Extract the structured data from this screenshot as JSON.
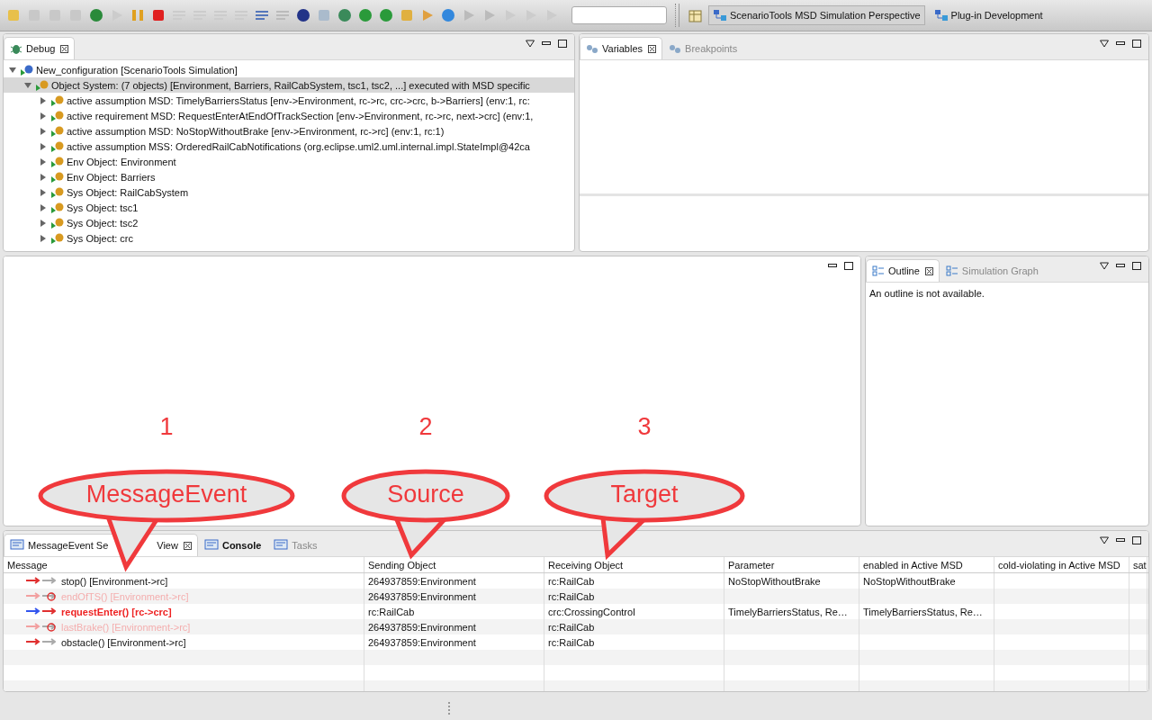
{
  "perspectives": [
    {
      "label": "ScenarioTools MSD Simulation Perspective",
      "selected": true
    },
    {
      "label": "Plug-in Development",
      "selected": false
    }
  ],
  "debug": {
    "tab": "Debug",
    "tree": [
      {
        "label": "New_configuration [ScenarioTools Simulation]",
        "kind": "launch",
        "expanded": true,
        "selected": false,
        "children": [
          {
            "label": "Object System: (7 objects) [Environment, Barriers, RailCabSystem, tsc1, tsc2, ...] executed with MSD specific",
            "kind": "system",
            "expanded": true,
            "selected": true,
            "children": [
              {
                "label": "active assumption MSD: TimelyBarriersStatus [env->Environment, rc->rc, crc->crc, b->Barriers] (env:1, rc:",
                "kind": "object",
                "expanded": false,
                "selected": false
              },
              {
                "label": "active requirement MSD: RequestEnterAtEndOfTrackSection [env->Environment, rc->rc, next->crc] (env:1,",
                "kind": "object",
                "expanded": false,
                "selected": false
              },
              {
                "label": "active assumption MSD: NoStopWithoutBrake [env->Environment, rc->rc] (env:1, rc:1)",
                "kind": "object",
                "expanded": false,
                "selected": false
              },
              {
                "label": "active assumption MSS: OrderedRailCabNotifications  (org.eclipse.uml2.uml.internal.impl.StateImpl@42ca",
                "kind": "object",
                "expanded": false,
                "selected": false
              },
              {
                "label": "Env Object: Environment",
                "kind": "object",
                "expanded": false,
                "selected": false
              },
              {
                "label": "Env Object: Barriers",
                "kind": "object",
                "expanded": false,
                "selected": false
              },
              {
                "label": "Sys Object: RailCabSystem",
                "kind": "object",
                "expanded": false,
                "selected": false
              },
              {
                "label": "Sys Object: tsc1",
                "kind": "object",
                "expanded": false,
                "selected": false
              },
              {
                "label": "Sys Object: tsc2",
                "kind": "object",
                "expanded": false,
                "selected": false
              },
              {
                "label": "Sys Object: crc",
                "kind": "object",
                "expanded": false,
                "selected": false
              }
            ]
          }
        ]
      }
    ]
  },
  "variables": {
    "tabs": [
      {
        "label": "Variables",
        "selected": true
      },
      {
        "label": "Breakpoints",
        "selected": false
      }
    ]
  },
  "outline": {
    "tabs": [
      {
        "label": "Outline",
        "selected": true
      },
      {
        "label": "Simulation Graph",
        "selected": false
      }
    ],
    "message": "An outline is not available."
  },
  "message_view": {
    "tabs": [
      {
        "label": "MessageEvent Se",
        "label_end": "View",
        "selected": true,
        "bold": false
      },
      {
        "label": "Console",
        "selected": false,
        "bold": true
      },
      {
        "label": "Tasks",
        "selected": false,
        "bold": false
      }
    ],
    "columns": [
      "Message",
      "Sending Object",
      "Receiving Object",
      "Parameter",
      "enabled in Active MSD",
      "cold-violating in Active MSD",
      "sat"
    ],
    "rows": [
      {
        "kind": "normal",
        "message": "stop() [Environment->rc]",
        "sending_object": "264937859:Environment",
        "receiving_object": "rc:RailCab",
        "parameter": "NoStopWithoutBrake",
        "enabled_in_active_msd": "NoStopWithoutBrake"
      },
      {
        "kind": "disabled",
        "message": "endOfTS() [Environment->rc]",
        "sending_object": "264937859:Environment",
        "receiving_object": "rc:RailCab"
      },
      {
        "kind": "active",
        "message": "requestEnter() [rc->crc]",
        "sending_object": "rc:RailCab",
        "receiving_object": "crc:CrossingControl",
        "parameter": "TimelyBarriersStatus, Re…",
        "enabled_in_active_msd": "TimelyBarriersStatus, Re…"
      },
      {
        "kind": "disabled",
        "message": "lastBrake() [Environment->rc]",
        "sending_object": "264937859:Environment",
        "receiving_object": "rc:RailCab"
      },
      {
        "kind": "normal",
        "message": "obstacle() [Environment->rc]",
        "sending_object": "264937859:Environment",
        "receiving_object": "rc:RailCab"
      }
    ]
  },
  "annotations": [
    {
      "number": "1",
      "label": "MessageEvent"
    },
    {
      "number": "2",
      "label": "Source"
    },
    {
      "number": "3",
      "label": "Target"
    }
  ]
}
